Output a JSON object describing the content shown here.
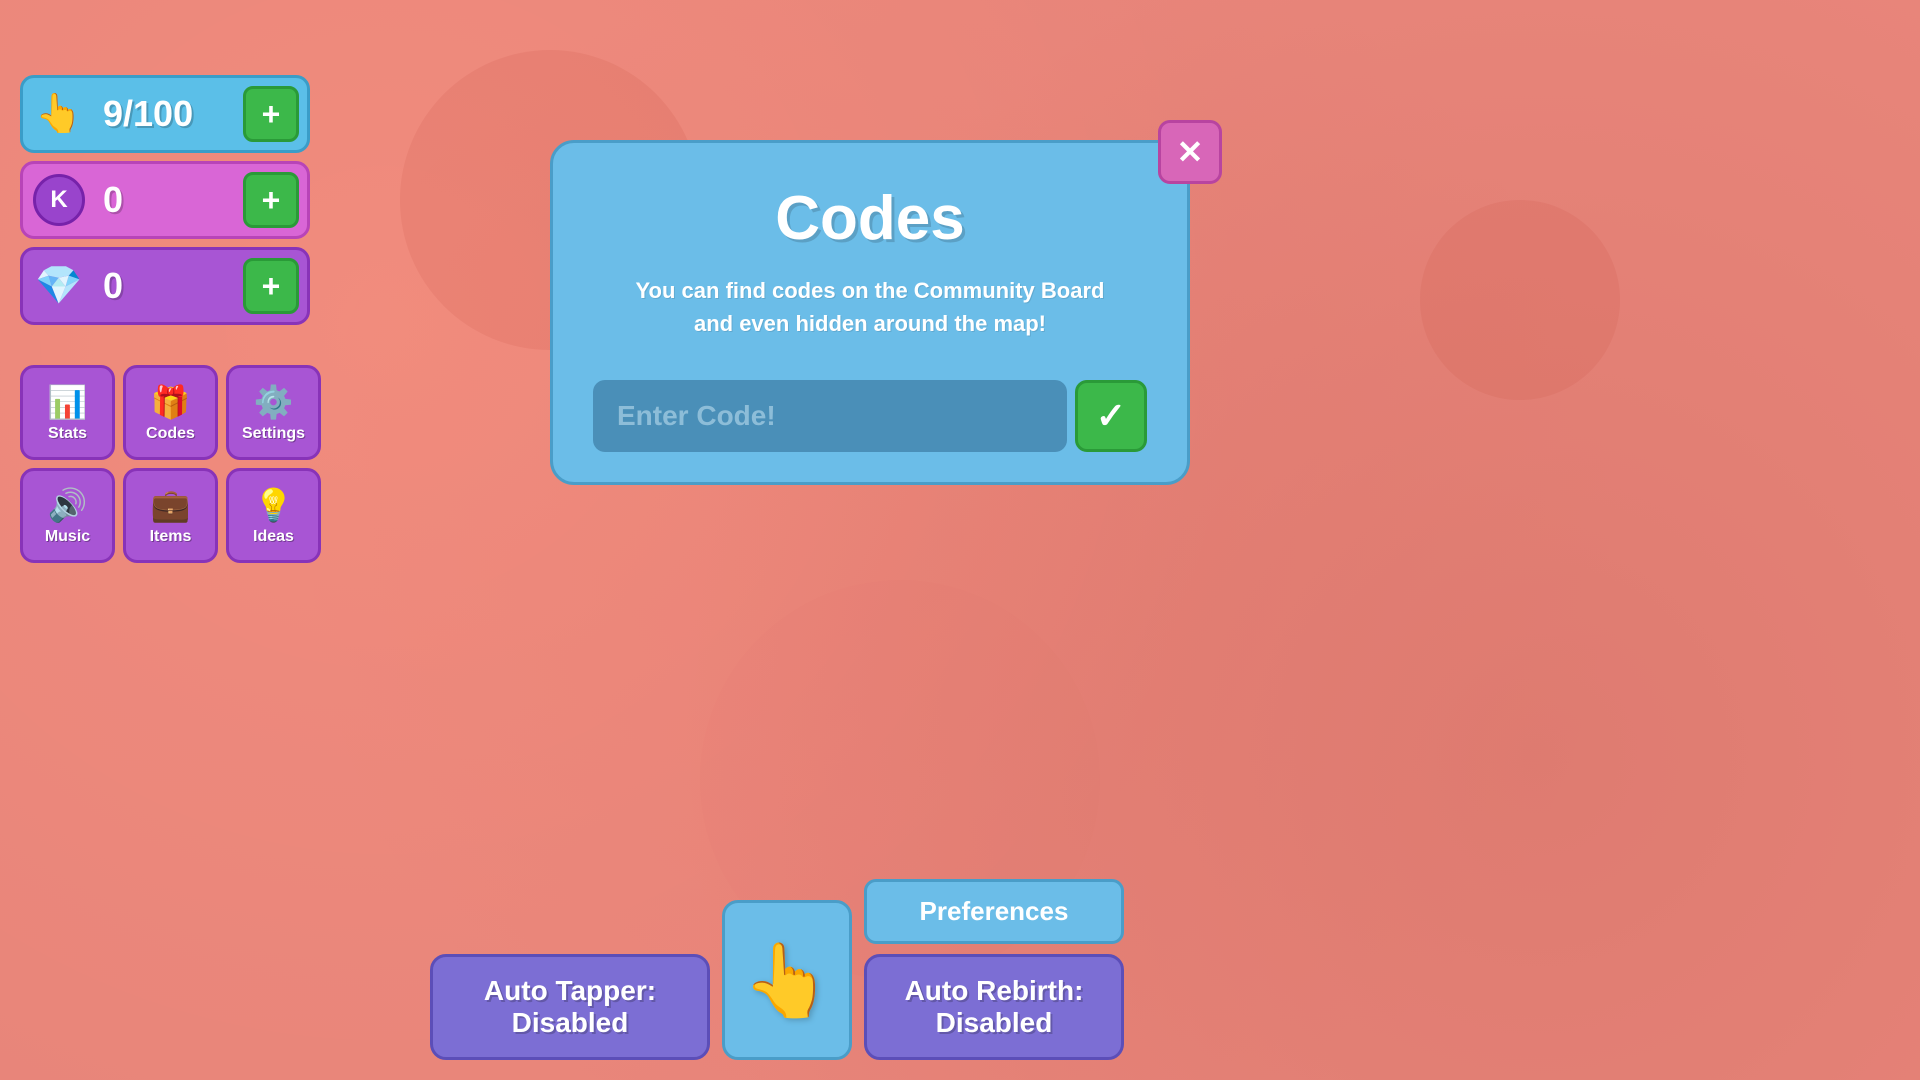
{
  "stats": {
    "clicks": {
      "value": "9/100",
      "plus_label": "+"
    },
    "k": {
      "value": "0",
      "icon_label": "K",
      "plus_label": "+"
    },
    "gems": {
      "value": "0",
      "plus_label": "+"
    }
  },
  "nav": {
    "buttons": [
      {
        "id": "stats",
        "label": "Stats",
        "icon": "📊"
      },
      {
        "id": "codes",
        "label": "Codes",
        "icon": "🎁"
      },
      {
        "id": "settings",
        "label": "Settings",
        "icon": "⚙️"
      },
      {
        "id": "music",
        "label": "Music",
        "icon": "🔊"
      },
      {
        "id": "items",
        "label": "Items",
        "icon": "💼"
      },
      {
        "id": "ideas",
        "label": "Ideas",
        "icon": "💡"
      }
    ]
  },
  "modal": {
    "title": "Codes",
    "description": "You can find codes on the Community Board and even hidden around the map!",
    "input_placeholder": "Enter Code!",
    "submit_icon": "✓"
  },
  "close_button": {
    "label": "✕"
  },
  "bottom": {
    "auto_tapper": "Auto Tapper:\nDisabled",
    "preferences": "Preferences",
    "auto_rebirth": "Auto Rebirth:\nDisabled"
  }
}
